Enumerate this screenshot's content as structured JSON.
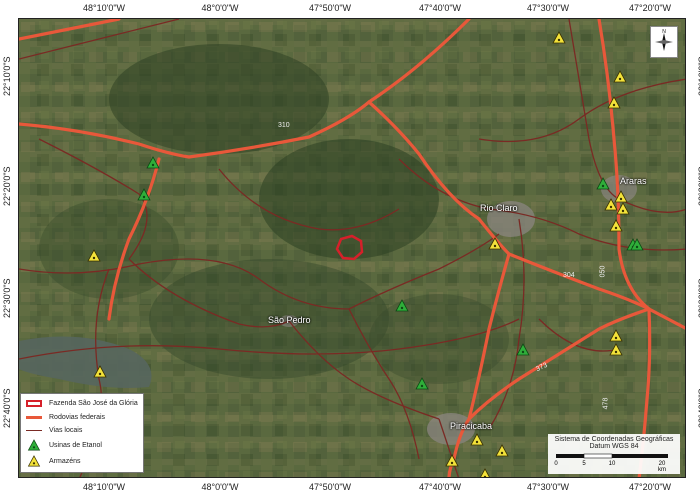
{
  "grid_labels": {
    "longitude": [
      "48°10'0\"W",
      "48°0'0\"W",
      "47°50'0\"W",
      "47°40'0\"W",
      "47°30'0\"W",
      "47°20'0\"W"
    ],
    "latitude": [
      "22°10'0\"S",
      "22°20'0\"S",
      "22°30'0\"S",
      "22°40'0\"S"
    ]
  },
  "places": {
    "rio_claro": "Rio Claro",
    "araras": "Araras",
    "sao_pedro": "São Pedro",
    "piracicaba": "Piracicaba"
  },
  "road_numbers": {
    "sp310": "310",
    "sp304": "304",
    "sp050": "050",
    "sp373": "373",
    "sp478": "478"
  },
  "legend": {
    "farm": "Fazenda São José da Glória",
    "federal_roads": "Rodovias federais",
    "local_roads": "Vias locais",
    "ethanol": "Usinas de Etanol",
    "warehouses": "Armazéns"
  },
  "scale_bar": {
    "ticks": [
      "0",
      "5",
      "10",
      "20"
    ],
    "unit": "km"
  },
  "crs": {
    "line1": "Sistema de Coordenadas Geográficas",
    "line2": "Datum WGS 84"
  },
  "north_arrow": {
    "icon": "north-arrow-icon",
    "label": "N"
  },
  "colors": {
    "imagery_base": "#4a5a36",
    "federal_road": "#e8583a",
    "local_road": "#7a2a24",
    "farm_outline": "#d6202a",
    "ethanol_marker": "#2fae3a",
    "warehouse_marker": "#f3e23a",
    "water": "#5a6a62"
  },
  "ethanol_count": 8,
  "warehouse_count": 16
}
